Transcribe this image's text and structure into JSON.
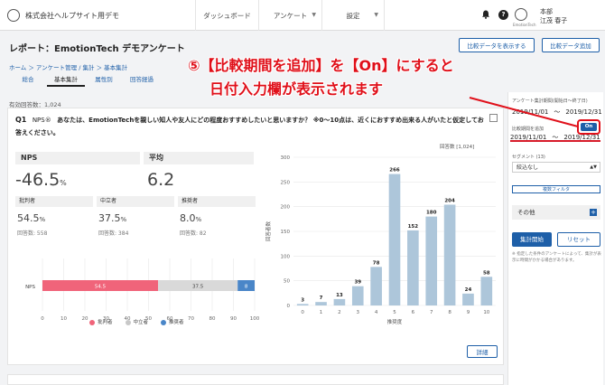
{
  "header": {
    "company": "株式会社ヘルプサイト用デモ",
    "nav": [
      {
        "label": "ダッシュボード"
      },
      {
        "label": "アンケート"
      },
      {
        "label": "設定"
      }
    ],
    "user_dept": "本部",
    "user_name": "江茂 春子",
    "avatar_label": "EmotionTech"
  },
  "report": {
    "title": "レポート：EmotionTech デモアンケート",
    "btn_compare": "比較データを表示する",
    "btn_export": "比較データ追加"
  },
  "breadcrumb": "ホーム ＞ アンケート管理 / 集計 ＞ 基本集計",
  "tabs": [
    {
      "label": "総合"
    },
    {
      "label": "基本集計"
    },
    {
      "label": "属性別"
    },
    {
      "label": "回答経過"
    }
  ],
  "annotation": {
    "line1": "⑤【比較期間を追加】を【On】にすると",
    "line2": "日付入力欄が表示されます"
  },
  "main": {
    "valid_responses": "有効回答数：1,024",
    "question_num": "Q1",
    "question_tag": "NPS®",
    "question_text": "あなたは、EmotionTechを親しい知人や友人にどの程度おすすめしたいと思いますか？ ※0〜10点は、近くにおすすめ出来る人がいたと仮定してお答えください。",
    "nps_label": "NPS",
    "nps_value": "-46.5",
    "nps_unit": "%",
    "avg_label": "平均",
    "avg_value": "6.2",
    "segments": [
      {
        "label": "批判者",
        "value": "54.5",
        "unit": "%",
        "count": "回答数: 558"
      },
      {
        "label": "中立者",
        "value": "37.5",
        "unit": "%",
        "count": "回答数: 384"
      },
      {
        "label": "推奨者",
        "value": "8.0",
        "unit": "%",
        "count": "回答数: 82"
      }
    ],
    "right_count": "回答数 [1,024]",
    "detail_button": "詳細"
  },
  "chart_data": [
    {
      "type": "bar",
      "orientation": "horizontal-stacked",
      "categories": [
        "NPS"
      ],
      "series": [
        {
          "name": "批判者",
          "values": [
            54.5
          ]
        },
        {
          "name": "中立者",
          "values": [
            37.5
          ]
        },
        {
          "name": "推奨者",
          "values": [
            8
          ]
        }
      ],
      "segment_labels": [
        "54.5",
        "37.5",
        "8"
      ],
      "xlim": [
        0,
        100
      ],
      "xticks": [
        "0",
        "10",
        "20",
        "30",
        "40",
        "50",
        "60",
        "70",
        "80",
        "90",
        "100"
      ],
      "legend": "bottom",
      "colors": [
        "#f0647a",
        "#d9d9d9",
        "#4a86c8"
      ]
    },
    {
      "type": "bar",
      "categories": [
        "0",
        "1",
        "2",
        "3",
        "4",
        "5",
        "6",
        "7",
        "8",
        "9",
        "10"
      ],
      "values": [
        3,
        7,
        13,
        39,
        78,
        266,
        152,
        180,
        204,
        24,
        58
      ],
      "ylim": [
        0,
        300
      ],
      "yticks": [
        "0",
        "50",
        "100",
        "150",
        "200",
        "250",
        "300"
      ],
      "xlabel": "推奨度",
      "ylabel": "回答者数",
      "grid": true,
      "color": "#adc6da"
    }
  ],
  "side": {
    "period_label": "アンケート集計期間(開始日〜終了日)",
    "period_start": "2019/11/01",
    "period_end": "2019/12/31",
    "compare_label": "比較期間を追加",
    "toggle": "On",
    "compare_start": "2019/11/01",
    "compare_end": "2019/12/31",
    "segment_label": "セグメント (13)",
    "segment_value": "絞込なし",
    "filter_btn": "複数フィルタ",
    "other": "その他",
    "run_btn": "集計開始",
    "reset_btn": "リセット",
    "note": "※ 指定した条件のアンケートによって、集計が表示に時間がかかる場合があります。",
    "tilde": "〜"
  }
}
